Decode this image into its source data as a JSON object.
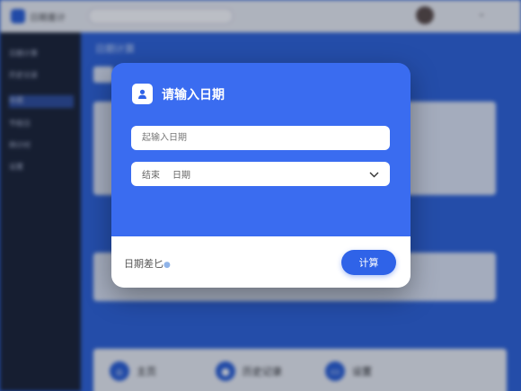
{
  "app": {
    "title": "日期差计"
  },
  "sidebar": {
    "items": [
      {
        "label": "日期计算"
      },
      {
        "label": "历史记录"
      },
      {
        "label": "收藏"
      },
      {
        "label": "节假日"
      },
      {
        "label": "倒计时"
      },
      {
        "label": "设置"
      }
    ]
  },
  "main": {
    "title": "日期计算"
  },
  "bottom_nav": {
    "items": [
      {
        "label": "主页",
        "icon": "home-icon"
      },
      {
        "label": "历史记录",
        "icon": "user-icon"
      },
      {
        "label": "设置",
        "icon": "settings-icon"
      }
    ]
  },
  "modal": {
    "title": "请输入日期",
    "start_field": {
      "placeholder": "起输入日期",
      "value": ""
    },
    "end_field": {
      "prefix": "结束",
      "placeholder": "日期"
    },
    "result_label": "日期差匕",
    "calculate_label": "计算"
  },
  "colors": {
    "accent": "#2f63e8",
    "modal_top": "#3a6cf0",
    "backdrop": "#2f63d8"
  }
}
